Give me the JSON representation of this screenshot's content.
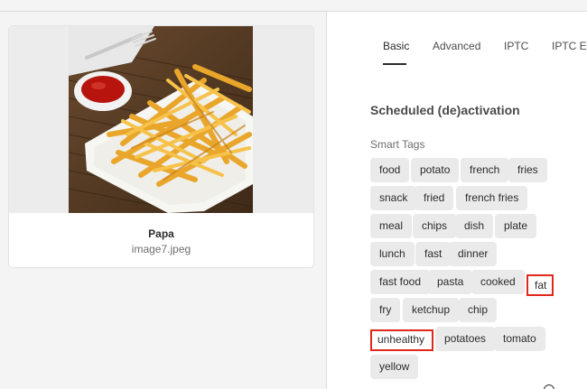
{
  "asset": {
    "title": "Papa",
    "filename": "image7.jpeg"
  },
  "tabs": [
    {
      "label": "Basic",
      "active": true
    },
    {
      "label": "Advanced",
      "active": false
    },
    {
      "label": "IPTC",
      "active": false
    },
    {
      "label": "IPTC Ext",
      "active": false
    }
  ],
  "section": {
    "title": "Scheduled (de)activation"
  },
  "smart_tags": {
    "label": "Smart Tags",
    "tags": [
      "food",
      "potato",
      "french",
      "fries",
      "snack",
      "fried",
      "french fries",
      "meal",
      "chips",
      "dish",
      "plate",
      "lunch",
      "fast",
      "dinner",
      "fast food",
      "pasta",
      "cooked",
      "fat",
      "fry",
      "ketchup",
      "chip",
      "unhealthy",
      "potatoes",
      "tomato",
      "yellow"
    ],
    "highlighted": [
      "fat",
      "unhealthy"
    ]
  },
  "colors": {
    "highlight": "#e0281c",
    "tag_bg": "#eaeaea",
    "pane_bg": "#f4f4f4"
  }
}
